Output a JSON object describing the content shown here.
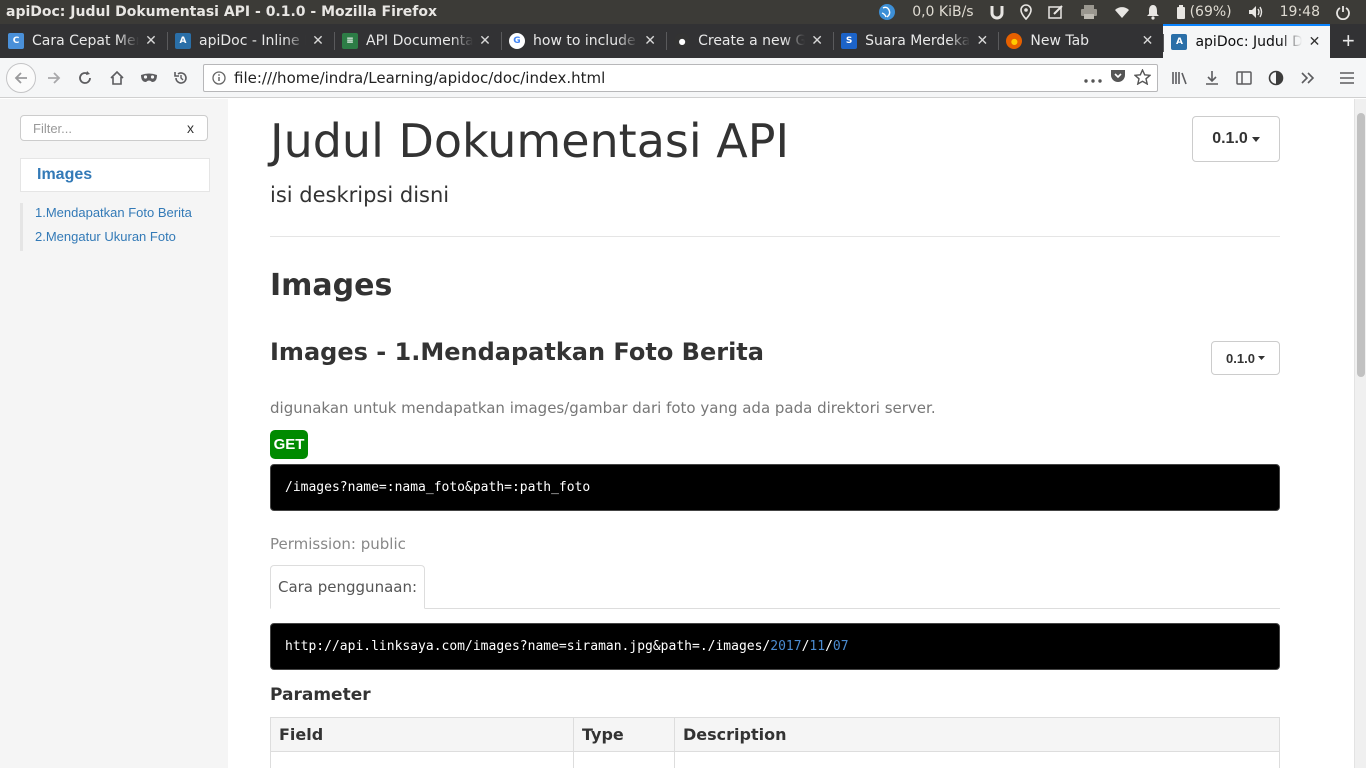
{
  "os_bar": {
    "window_title": "apiDoc: Judul Dokumentasi API - 0.1.0 - Mozilla Firefox",
    "net_speed": "0,0 KiB/s",
    "battery": "(69%)",
    "time": "19:48"
  },
  "tabs": [
    {
      "label": "Cara Cepat Mem",
      "favicon_color": "#4a90d9",
      "favicon": "C"
    },
    {
      "label": "apiDoc - Inline D",
      "favicon_color": "#2a6fa8",
      "favicon": "A"
    },
    {
      "label": "API Documenta",
      "favicon_color": "#2d7d46",
      "favicon": "≡"
    },
    {
      "label": "how to include",
      "favicon_color": "#ffffff",
      "favicon": "G"
    },
    {
      "label": "Create a new Gi",
      "favicon_color": "#333333",
      "favicon": "●"
    },
    {
      "label": "Suara Merdeka",
      "favicon_color": "#1c63c8",
      "favicon": "S"
    },
    {
      "label": "New Tab",
      "favicon_color": "#e66000",
      "favicon": "●"
    },
    {
      "label": "apiDoc: Judul D",
      "favicon_color": "#2a6fa8",
      "favicon": "A",
      "active": true
    }
  ],
  "url": "file:///home/indra/Learning/apidoc/doc/index.html",
  "sidebar": {
    "filter_placeholder": "Filter...",
    "filter_clear": "x",
    "group": "Images",
    "items": [
      "1.Mendapatkan Foto Berita",
      "2.Mengatur Ukuran Foto"
    ]
  },
  "main": {
    "title": "Judul Dokumentasi API",
    "version": "0.1.0",
    "description": "isi deskripsi disni",
    "group_title": "Images",
    "section_title": "Images - 1.Mendapatkan Foto Berita",
    "section_version": "0.1.0",
    "section_desc": "digunakan untuk mendapatkan images/gambar dari foto yang ada pada direktori server.",
    "method": "GET",
    "endpoint": "/images?name=:nama_foto&path=:path_foto",
    "permission": "Permission: public",
    "example_tab": "Cara penggunaan:",
    "example_prefix": "http://api.linksaya.com/images?name=siraman.jpg&path=./images/",
    "example_y": "2017",
    "example_m": "11",
    "example_d": "07",
    "example_sep": "/",
    "param_title": "Parameter",
    "table_headers": [
      "Field",
      "Type",
      "Description"
    ]
  }
}
